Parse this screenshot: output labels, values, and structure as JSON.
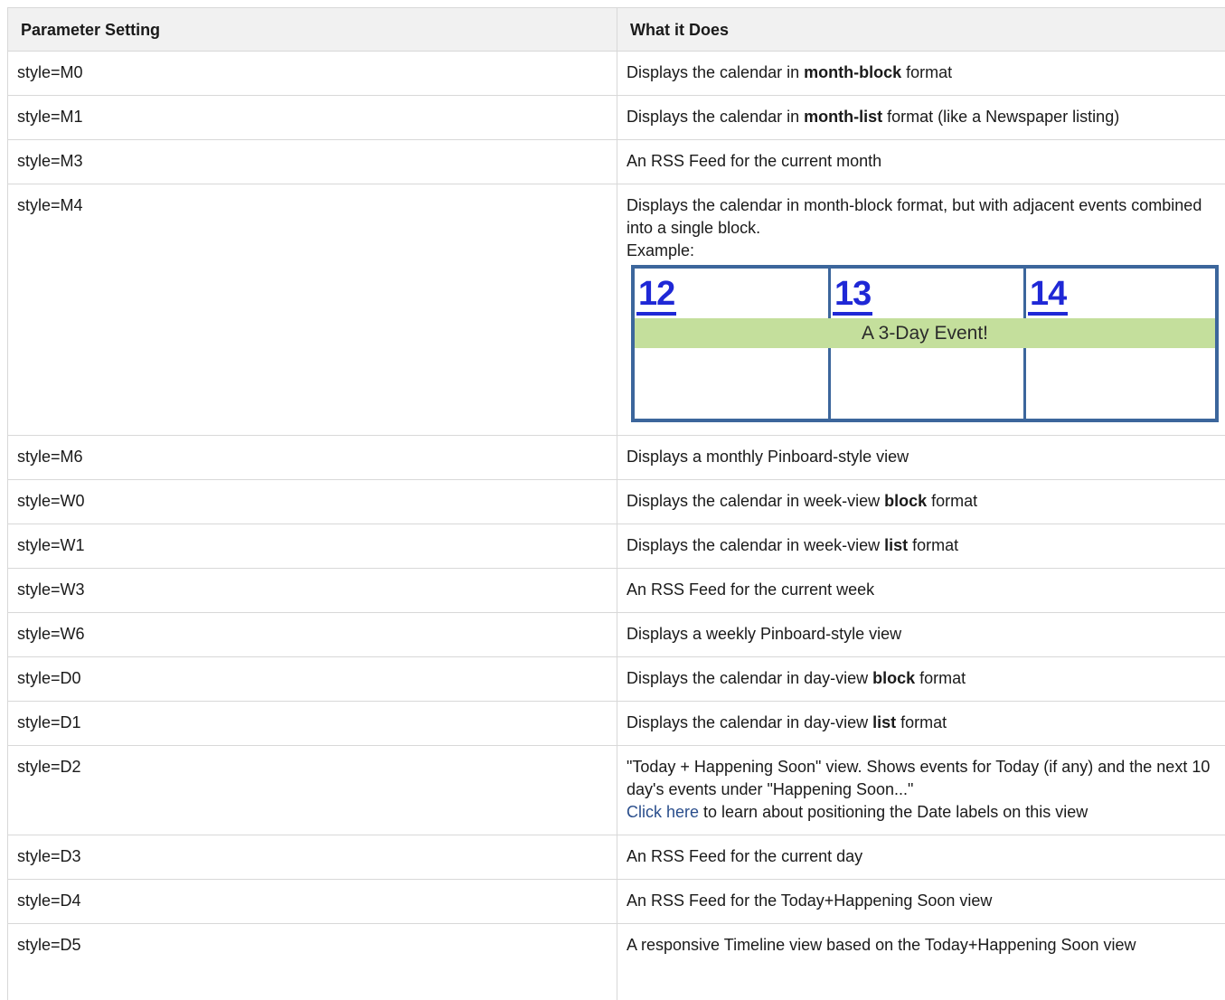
{
  "table": {
    "headers": [
      "Parameter Setting",
      "What it Does"
    ],
    "rows": [
      {
        "param": "style=M0",
        "pre": "Displays the calendar in ",
        "bold": "month-block",
        "post": " format"
      },
      {
        "param": "style=M1",
        "pre": "Displays the calendar in ",
        "bold": "month-list",
        "post": " format (like a Newspaper listing)"
      },
      {
        "param": "style=M3",
        "text": "An RSS Feed for the current month"
      },
      {
        "param": "style=M4",
        "text": "Displays the calendar in month-block format, but with adjacent events combined into a single block.",
        "example_label": "Example:"
      },
      {
        "param": "style=M6",
        "text": "Displays a monthly Pinboard-style view"
      },
      {
        "param": "style=W0",
        "pre": "Displays the calendar in week-view ",
        "bold": "block",
        "post": " format"
      },
      {
        "param": "style=W1",
        "pre": "Displays the calendar in week-view ",
        "bold": "list",
        "post": " format"
      },
      {
        "param": "style=W3",
        "text": "An RSS Feed for the current week"
      },
      {
        "param": "style=W6",
        "text": "Displays a weekly Pinboard-style view"
      },
      {
        "param": "style=D0",
        "pre": "Displays the calendar in day-view ",
        "bold": "block",
        "post": " format"
      },
      {
        "param": "style=D1",
        "pre": "Displays the calendar in day-view ",
        "bold": "list",
        "post": " format"
      },
      {
        "param": "style=D2",
        "text": "\"Today + Happening Soon\" view. Shows events for Today (if any) and the next 10 day's events under \"Happening Soon...\"",
        "link_text": "Click here",
        "link_post": " to learn about positioning the Date labels on this view"
      },
      {
        "param": "style=D3",
        "text": "An RSS Feed for the current day"
      },
      {
        "param": "style=D4",
        "text": "An RSS Feed for the Today+Happening Soon view"
      },
      {
        "param": "style=D5",
        "text": "A responsive Timeline view based on the Today+Happening Soon view"
      }
    ]
  },
  "example_calendar": {
    "days": [
      "12",
      "13",
      "14"
    ],
    "event": "A 3-Day Event!"
  },
  "colors": {
    "header_bg": "#f1f1f1",
    "border": "#d8d8d8",
    "calendar_border": "#3c669c",
    "day_number": "#1f28d6",
    "event_bg": "#c4df9c",
    "link": "#2a4e8c"
  }
}
